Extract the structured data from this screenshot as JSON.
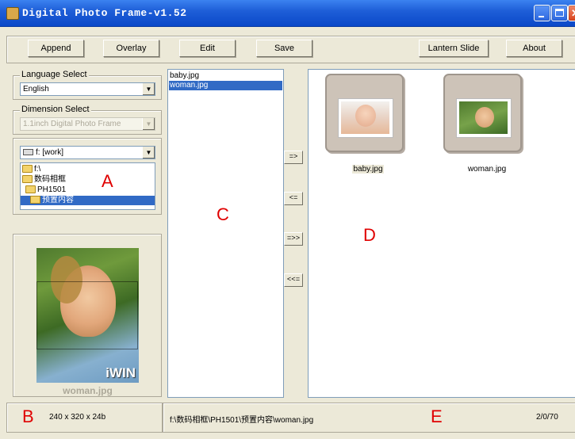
{
  "window": {
    "title": "Digital Photo Frame-v1.52"
  },
  "toolbar": {
    "append": "Append",
    "overlay": "Overlay",
    "edit": "Edit",
    "save": "Save",
    "lantern_slide": "Lantern Slide",
    "about": "About"
  },
  "language": {
    "label": "Language Select",
    "value": "English"
  },
  "dimension": {
    "label": "Dimension Select",
    "value": "1.1inch Digital Photo Frame"
  },
  "drive": {
    "value": "f: [work]"
  },
  "tree": [
    "f:\\",
    "数码相框",
    "PH1501",
    "预置内容"
  ],
  "files": [
    "baby.jpg",
    "woman.jpg"
  ],
  "arrows": [
    "=>",
    "<=",
    "=>>",
    "<<="
  ],
  "thumbnails": [
    {
      "caption": "baby.jpg"
    },
    {
      "caption": "woman.jpg"
    }
  ],
  "preview": {
    "brand": "iWIN",
    "caption": "woman.jpg"
  },
  "annotations": {
    "a": "A",
    "b": "B",
    "c": "C",
    "d": "D",
    "e": "E"
  },
  "status": {
    "dimensions": "240 x 320 x 24b",
    "path": "f:\\数码相框\\PH1501\\预置内容\\woman.jpg",
    "count": "2/0/70"
  },
  "colors": {
    "title_bar": "#0a48c8",
    "selection": "#316ac5",
    "annotation": "#e00000"
  }
}
